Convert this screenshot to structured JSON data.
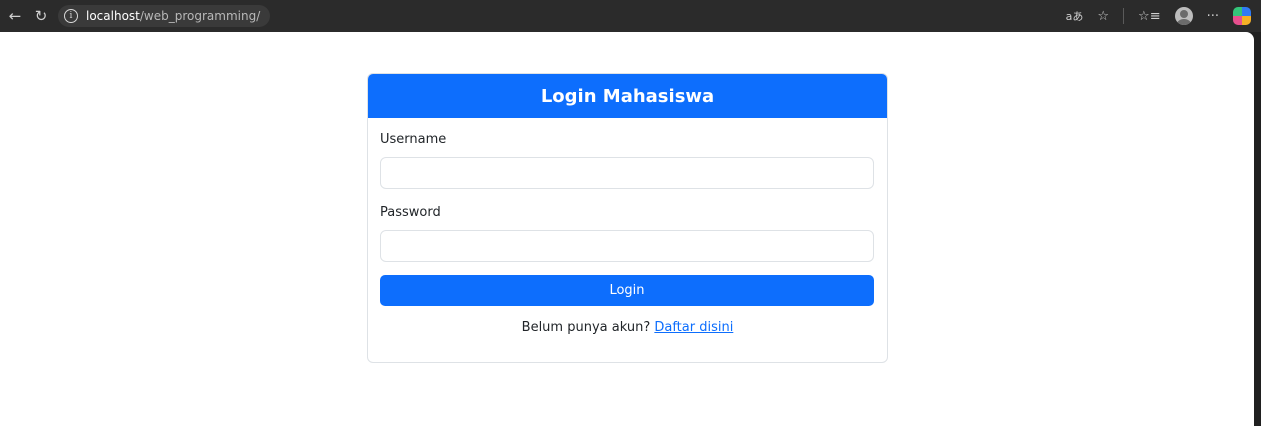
{
  "browser": {
    "url_host": "localhost",
    "url_path": "/web_programming/",
    "read_aloud_glyph": "aあ",
    "more_glyph": "···"
  },
  "login": {
    "title": "Login Mahasiswa",
    "username_label": "Username",
    "username_value": "",
    "password_label": "Password",
    "password_value": "",
    "submit_label": "Login",
    "register_prompt": "Belum punya akun?",
    "register_link": "Daftar disini"
  },
  "colors": {
    "primary": "#0d6efd",
    "border": "#dee2e6",
    "browser_chrome": "#2b2b2b"
  }
}
